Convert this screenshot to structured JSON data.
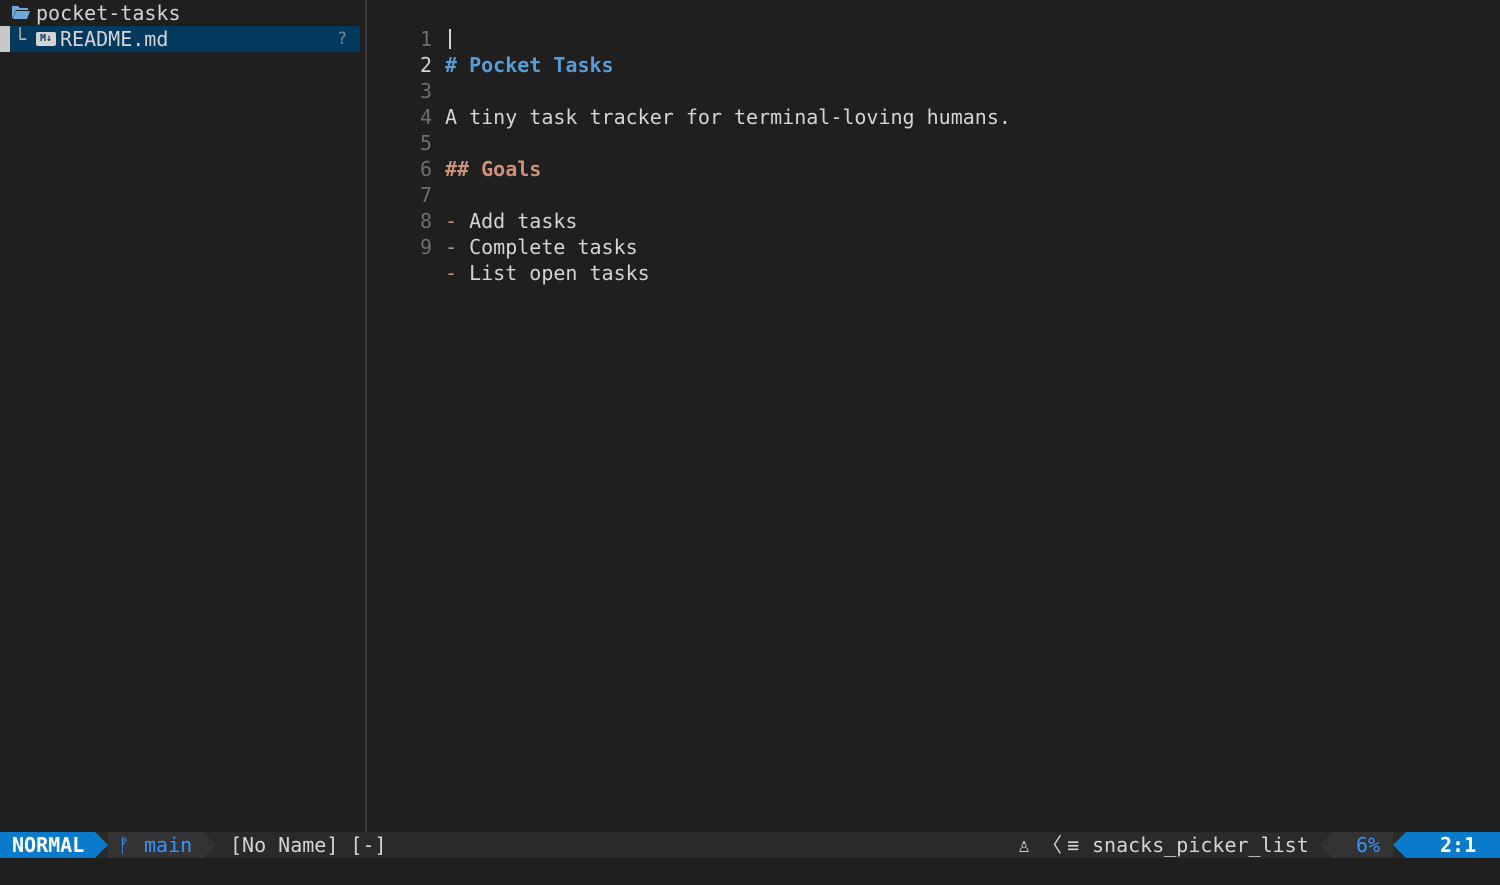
{
  "explorer": {
    "root": {
      "label": "pocket-tasks",
      "icon": "folder-open-icon"
    },
    "items": [
      {
        "guide": "└",
        "icon": "markdown-icon",
        "icon_text": "M↓",
        "label": "README.md",
        "git_status": "?"
      }
    ]
  },
  "editor": {
    "current_line": 2,
    "lines": [
      {
        "num": "1",
        "text": "# Pocket Tasks",
        "style": "h1"
      },
      {
        "num": "2",
        "text": "",
        "style": "plain"
      },
      {
        "num": "3",
        "text": "A tiny task tracker for terminal-loving humans.",
        "style": "plain"
      },
      {
        "num": "4",
        "text": "",
        "style": "plain"
      },
      {
        "num": "5",
        "text": "## Goals",
        "style": "h2"
      },
      {
        "num": "6",
        "text": "",
        "style": "plain"
      },
      {
        "num": "7",
        "bullet": "-",
        "text": " Add tasks",
        "style": "bullet"
      },
      {
        "num": "8",
        "bullet": "-",
        "text": " Complete tasks",
        "style": "bullet"
      },
      {
        "num": "9",
        "bullet": "-",
        "text": " List open tasks",
        "style": "bullet"
      }
    ]
  },
  "statusline": {
    "mode": "NORMAL",
    "branch_icon": "ᚠ",
    "branch": "main",
    "buffer": "[No Name] [-]",
    "os_icon": "♙",
    "separator_icon": "〈",
    "filetype_icon": "≡",
    "filetype": "snacks_picker_list",
    "percent": "6%",
    "position": "2:1"
  },
  "colors": {
    "background": "#1f1f1f",
    "selection": "#04395e",
    "accent": "#0a7aca",
    "heading1": "#569cd6",
    "heading2": "#ce9178"
  }
}
